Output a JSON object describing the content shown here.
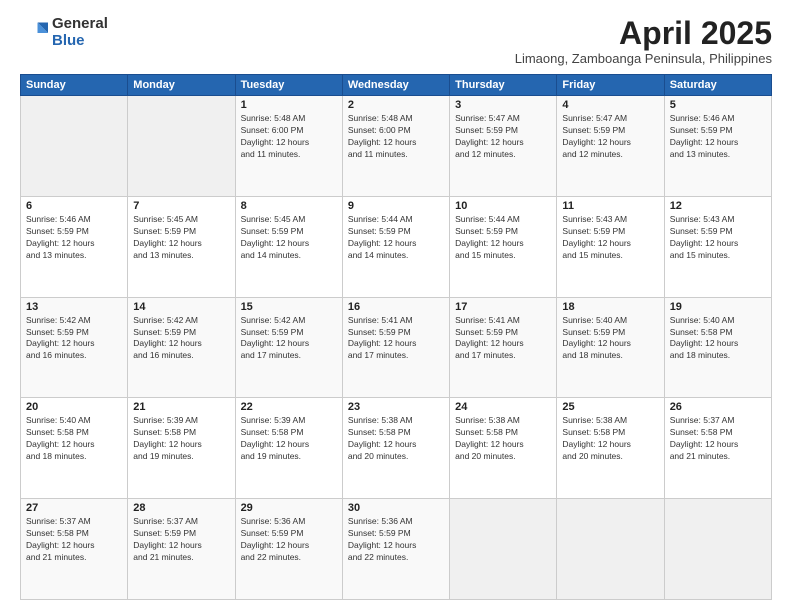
{
  "logo": {
    "general": "General",
    "blue": "Blue"
  },
  "header": {
    "month": "April 2025",
    "location": "Limaong, Zamboanga Peninsula, Philippines"
  },
  "weekdays": [
    "Sunday",
    "Monday",
    "Tuesday",
    "Wednesday",
    "Thursday",
    "Friday",
    "Saturday"
  ],
  "weeks": [
    [
      {
        "day": "",
        "info": ""
      },
      {
        "day": "",
        "info": ""
      },
      {
        "day": "1",
        "info": "Sunrise: 5:48 AM\nSunset: 6:00 PM\nDaylight: 12 hours\nand 11 minutes."
      },
      {
        "day": "2",
        "info": "Sunrise: 5:48 AM\nSunset: 6:00 PM\nDaylight: 12 hours\nand 11 minutes."
      },
      {
        "day": "3",
        "info": "Sunrise: 5:47 AM\nSunset: 5:59 PM\nDaylight: 12 hours\nand 12 minutes."
      },
      {
        "day": "4",
        "info": "Sunrise: 5:47 AM\nSunset: 5:59 PM\nDaylight: 12 hours\nand 12 minutes."
      },
      {
        "day": "5",
        "info": "Sunrise: 5:46 AM\nSunset: 5:59 PM\nDaylight: 12 hours\nand 13 minutes."
      }
    ],
    [
      {
        "day": "6",
        "info": "Sunrise: 5:46 AM\nSunset: 5:59 PM\nDaylight: 12 hours\nand 13 minutes."
      },
      {
        "day": "7",
        "info": "Sunrise: 5:45 AM\nSunset: 5:59 PM\nDaylight: 12 hours\nand 13 minutes."
      },
      {
        "day": "8",
        "info": "Sunrise: 5:45 AM\nSunset: 5:59 PM\nDaylight: 12 hours\nand 14 minutes."
      },
      {
        "day": "9",
        "info": "Sunrise: 5:44 AM\nSunset: 5:59 PM\nDaylight: 12 hours\nand 14 minutes."
      },
      {
        "day": "10",
        "info": "Sunrise: 5:44 AM\nSunset: 5:59 PM\nDaylight: 12 hours\nand 15 minutes."
      },
      {
        "day": "11",
        "info": "Sunrise: 5:43 AM\nSunset: 5:59 PM\nDaylight: 12 hours\nand 15 minutes."
      },
      {
        "day": "12",
        "info": "Sunrise: 5:43 AM\nSunset: 5:59 PM\nDaylight: 12 hours\nand 15 minutes."
      }
    ],
    [
      {
        "day": "13",
        "info": "Sunrise: 5:42 AM\nSunset: 5:59 PM\nDaylight: 12 hours\nand 16 minutes."
      },
      {
        "day": "14",
        "info": "Sunrise: 5:42 AM\nSunset: 5:59 PM\nDaylight: 12 hours\nand 16 minutes."
      },
      {
        "day": "15",
        "info": "Sunrise: 5:42 AM\nSunset: 5:59 PM\nDaylight: 12 hours\nand 17 minutes."
      },
      {
        "day": "16",
        "info": "Sunrise: 5:41 AM\nSunset: 5:59 PM\nDaylight: 12 hours\nand 17 minutes."
      },
      {
        "day": "17",
        "info": "Sunrise: 5:41 AM\nSunset: 5:59 PM\nDaylight: 12 hours\nand 17 minutes."
      },
      {
        "day": "18",
        "info": "Sunrise: 5:40 AM\nSunset: 5:59 PM\nDaylight: 12 hours\nand 18 minutes."
      },
      {
        "day": "19",
        "info": "Sunrise: 5:40 AM\nSunset: 5:58 PM\nDaylight: 12 hours\nand 18 minutes."
      }
    ],
    [
      {
        "day": "20",
        "info": "Sunrise: 5:40 AM\nSunset: 5:58 PM\nDaylight: 12 hours\nand 18 minutes."
      },
      {
        "day": "21",
        "info": "Sunrise: 5:39 AM\nSunset: 5:58 PM\nDaylight: 12 hours\nand 19 minutes."
      },
      {
        "day": "22",
        "info": "Sunrise: 5:39 AM\nSunset: 5:58 PM\nDaylight: 12 hours\nand 19 minutes."
      },
      {
        "day": "23",
        "info": "Sunrise: 5:38 AM\nSunset: 5:58 PM\nDaylight: 12 hours\nand 20 minutes."
      },
      {
        "day": "24",
        "info": "Sunrise: 5:38 AM\nSunset: 5:58 PM\nDaylight: 12 hours\nand 20 minutes."
      },
      {
        "day": "25",
        "info": "Sunrise: 5:38 AM\nSunset: 5:58 PM\nDaylight: 12 hours\nand 20 minutes."
      },
      {
        "day": "26",
        "info": "Sunrise: 5:37 AM\nSunset: 5:58 PM\nDaylight: 12 hours\nand 21 minutes."
      }
    ],
    [
      {
        "day": "27",
        "info": "Sunrise: 5:37 AM\nSunset: 5:58 PM\nDaylight: 12 hours\nand 21 minutes."
      },
      {
        "day": "28",
        "info": "Sunrise: 5:37 AM\nSunset: 5:59 PM\nDaylight: 12 hours\nand 21 minutes."
      },
      {
        "day": "29",
        "info": "Sunrise: 5:36 AM\nSunset: 5:59 PM\nDaylight: 12 hours\nand 22 minutes."
      },
      {
        "day": "30",
        "info": "Sunrise: 5:36 AM\nSunset: 5:59 PM\nDaylight: 12 hours\nand 22 minutes."
      },
      {
        "day": "",
        "info": ""
      },
      {
        "day": "",
        "info": ""
      },
      {
        "day": "",
        "info": ""
      }
    ]
  ]
}
